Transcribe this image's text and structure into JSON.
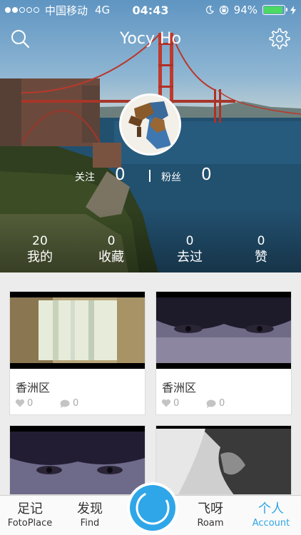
{
  "status_bar": {
    "carrier": "中国移动",
    "network": "4G",
    "time": "04:43",
    "battery_percent": "94%",
    "battery_level": 0.94,
    "signal_bars_filled": 2,
    "signal_bars_total": 5
  },
  "header": {
    "title": "Yocy Ho",
    "search_icon": "search-icon",
    "settings_icon": "gear-icon"
  },
  "profile": {
    "following_label": "关注",
    "following_count": "0",
    "fans_label": "粉丝",
    "fans_count": "0"
  },
  "stats": [
    {
      "value": "20",
      "label": "我的"
    },
    {
      "value": "0",
      "label": "收藏"
    },
    {
      "value": "0",
      "label": "去过"
    },
    {
      "value": "0",
      "label": "赞"
    }
  ],
  "cards": [
    {
      "place": "香洲区",
      "likes": "0",
      "comments": "0"
    },
    {
      "place": "香洲区",
      "likes": "0",
      "comments": "0"
    }
  ],
  "tabbar": {
    "tabs": [
      {
        "zh": "足记",
        "en": "FotoPlace"
      },
      {
        "zh": "发现",
        "en": "Find"
      },
      {
        "zh": "飞呀",
        "en": "Roam"
      },
      {
        "zh": "个人",
        "en": "Account"
      }
    ],
    "active_index": 3
  },
  "colors": {
    "accent": "#2fa5e6",
    "battery_green": "#4cd964",
    "background": "#ececec"
  }
}
